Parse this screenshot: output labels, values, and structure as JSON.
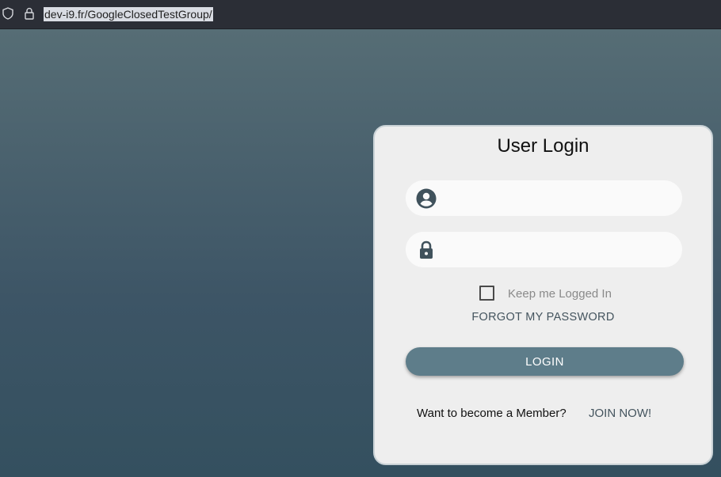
{
  "browser": {
    "url": "dev-i9.fr/GoogleClosedTestGroup/",
    "shield_icon": "shield-icon",
    "lock_icon": "lock-icon"
  },
  "login_card": {
    "title": "User Login",
    "username": {
      "value": "",
      "placeholder": "",
      "icon": "account-circle-icon"
    },
    "password": {
      "value": "",
      "placeholder": "",
      "icon": "padlock-icon"
    },
    "remember_label": "Keep me Logged In",
    "remember_checked": false,
    "forgot_label": "FORGOT MY PASSWORD",
    "login_label": "LOGIN",
    "member_prompt": "Want to become a Member?",
    "join_label": "JOIN NOW!"
  },
  "colors": {
    "accent": "#5e7d8a",
    "link": "#44545e",
    "background_top": "#566d75",
    "background_bottom": "#34505f",
    "card": "#eeeeee"
  }
}
